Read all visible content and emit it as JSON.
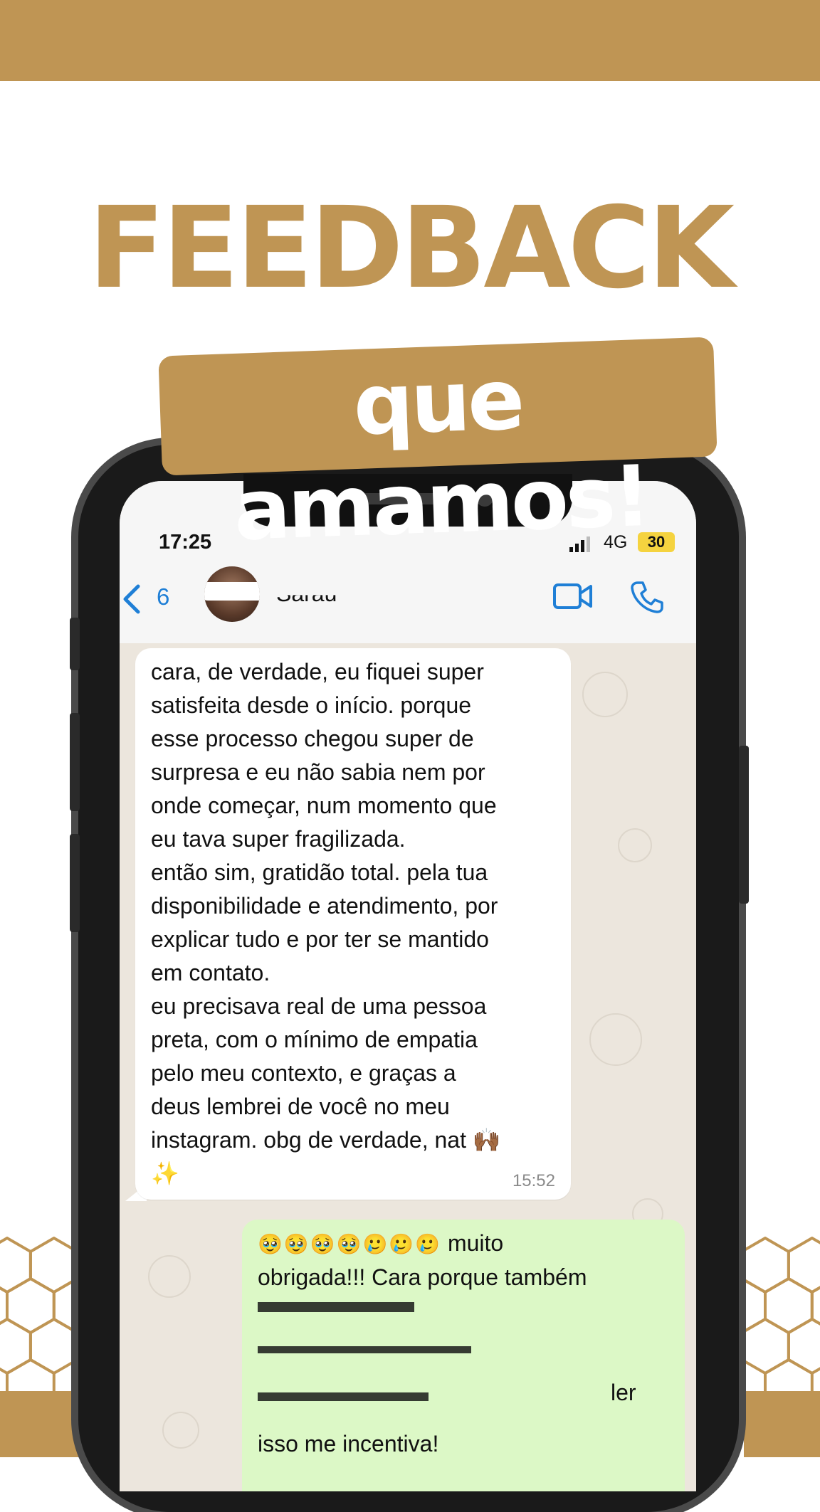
{
  "colors": {
    "brand": "#bf9554",
    "incoming_bubble": "#ffffff",
    "outgoing_bubble": "#dcf8c6",
    "link_blue": "#1f7fd6"
  },
  "headline": "FEEDBACK",
  "tagline": "que amamos!",
  "phone": {
    "status_bar": {
      "time": "17:25",
      "network": "4G",
      "battery": "30"
    },
    "chat_header": {
      "back_count": "6",
      "contact_name": "Sarau",
      "icons": [
        "chevron-left-icon",
        "video-call-icon",
        "voice-call-icon"
      ]
    },
    "messages": [
      {
        "direction": "incoming",
        "text": "cara, de verdade, eu fiquei super\nsatisfeita desde o início. porque\nesse processo chegou super de\nsurpresa e eu não sabia nem por\nonde começar, num momento que\neu tava super fragilizada.\nentão sim, gratidão total. pela tua\ndisponibilidade e atendimento, por\nexplicar tudo e por ter se mantido\nem contato.\neu precisava real de uma pessoa\npreta, com o mínimo de empatia\npelo meu contexto, e graças a\ndeus lembrei de você no meu\ninstagram. obg de verdade, nat 🙌🏾\n✨",
        "time": "15:52"
      },
      {
        "direction": "outgoing",
        "emojis": "🥹🥹🥹🥹🥲🥲🥲",
        "text_first": " muito\nobrigada!!! Cara porque também",
        "text_visible_end_a": "ler",
        "text_last": "isso me incentiva!"
      }
    ]
  }
}
